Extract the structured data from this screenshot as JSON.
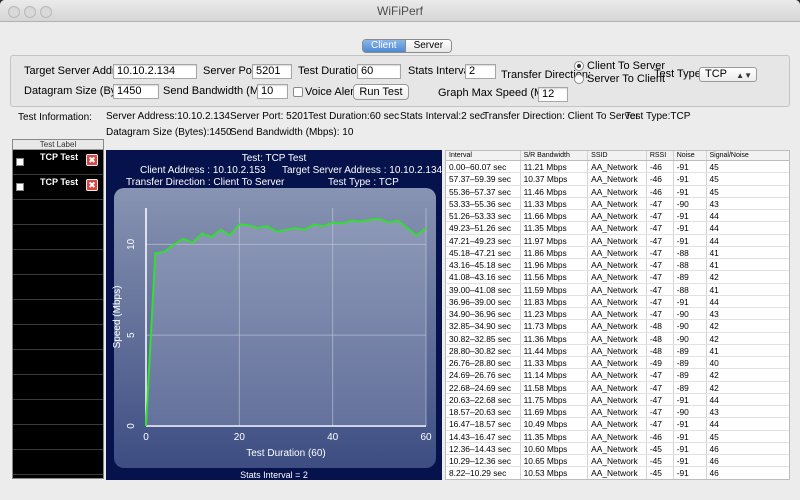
{
  "window": {
    "title": "WiFiPerf"
  },
  "tabs": [
    {
      "label": "Client",
      "selected": true
    },
    {
      "label": "Server",
      "selected": false
    }
  ],
  "config": {
    "target_server_address_label": "Target Server Address:",
    "target_server_address": "10.10.2.134",
    "server_port_label": "Server Port:",
    "server_port": "5201",
    "test_duration_label": "Test Duration:",
    "test_duration": "60",
    "stats_interval_label": "Stats Interval:",
    "stats_interval": "2",
    "transfer_direction_label": "Transfer Direction:",
    "direction_options": [
      "Client To Server",
      "Server To Client"
    ],
    "direction_selected": 0,
    "test_type_label": "Test Type:",
    "test_type": "TCP",
    "datagram_size_label": "Datagram Size (Bytes):",
    "datagram_size": "1450",
    "send_bandwidth_label": "Send Bandwidth (Mbps):",
    "send_bandwidth": "10",
    "voice_alert_label": "Voice Alert",
    "voice_alert": false,
    "run_test_label": "Run Test",
    "graph_max_speed_label": "Graph Max Speed (Mbps):",
    "graph_max_speed": "12"
  },
  "info": {
    "label": "Test Information:",
    "server_address": "Server Address:10.10.2.134",
    "server_port": "Server Port: 5201",
    "test_duration": "Test Duration:60 sec",
    "stats_interval": "Stats Interval:2 sec",
    "transfer_direction": "Transfer Direction: Client To Server",
    "test_type": "Test Type:TCP",
    "datagram_size": "Datagram Size (Bytes):1450",
    "send_bandwidth": "Send Bandwidth (Mbps): 10"
  },
  "test_list": {
    "header": "Test Label",
    "items": [
      {
        "label": "TCP Test"
      },
      {
        "label": "TCP Test"
      }
    ],
    "remove_glyph": "✖"
  },
  "graph": {
    "title": "Test: TCP Test",
    "client_address": "Client Address : 10.10.2.153",
    "target_server_address": "Target Server Address : 10.10.2.134",
    "transfer_direction": "Transfer Direction : Client To Server",
    "test_type": "Test Type : TCP",
    "stats_interval": "Stats Interval = 2"
  },
  "chart_data": {
    "type": "line",
    "xlabel": "Test Duration (60)",
    "ylabel": "Speed (Mbps)",
    "xlim": [
      0,
      60
    ],
    "ylim": [
      0,
      12
    ],
    "xticks": [
      0,
      20,
      40,
      60
    ],
    "yticks": [
      0,
      5,
      10
    ],
    "grid": true,
    "line_color": "#33dd33",
    "series": [
      {
        "x": [
          0,
          2,
          4,
          6,
          8,
          10,
          12,
          14,
          16,
          18,
          20,
          22,
          24,
          26,
          28,
          30,
          32,
          34,
          36,
          38,
          40,
          42,
          44,
          46,
          48,
          50,
          52,
          54,
          56,
          58,
          60
        ],
        "values": [
          0,
          9.5,
          9.6,
          10,
          10.3,
          10.1,
          10.6,
          10.4,
          10.8,
          10.5,
          11.1,
          11.05,
          10.9,
          11.0,
          10.7,
          10.8,
          10.9,
          10.8,
          11.1,
          11.0,
          11.2,
          11.15,
          11.3,
          11.25,
          11.35,
          11.4,
          11.2,
          11.3,
          10.9,
          10.5,
          10.9
        ]
      }
    ]
  },
  "table": {
    "columns": [
      "Interval",
      "S/R Bandwidth",
      "SSID",
      "RSSI",
      "Noise",
      "Signal/Noise"
    ],
    "rows": [
      [
        "0.00–60.07 sec",
        "11.21 Mbps",
        "AA_Network",
        "-46",
        "-91",
        "45"
      ],
      [
        "57.37–59.39 sec",
        "10.37 Mbps",
        "AA_Network",
        "-46",
        "-91",
        "45"
      ],
      [
        "55.36–57.37 sec",
        "11.46 Mbps",
        "AA_Network",
        "-46",
        "-91",
        "45"
      ],
      [
        "53.33–55.36 sec",
        "11.33 Mbps",
        "AA_Network",
        "-47",
        "-90",
        "43"
      ],
      [
        "51.26–53.33 sec",
        "11.66 Mbps",
        "AA_Network",
        "-47",
        "-91",
        "44"
      ],
      [
        "49.23–51.26 sec",
        "11.35 Mbps",
        "AA_Network",
        "-47",
        "-91",
        "44"
      ],
      [
        "47.21–49.23 sec",
        "11.97 Mbps",
        "AA_Network",
        "-47",
        "-91",
        "44"
      ],
      [
        "45.18–47.21 sec",
        "11.86 Mbps",
        "AA_Network",
        "-47",
        "-88",
        "41"
      ],
      [
        "43.16–45.18 sec",
        "11.96 Mbps",
        "AA_Network",
        "-47",
        "-88",
        "41"
      ],
      [
        "41.08–43.16 sec",
        "11.56 Mbps",
        "AA_Network",
        "-47",
        "-89",
        "42"
      ],
      [
        "39.00–41.08 sec",
        "11.59 Mbps",
        "AA_Network",
        "-47",
        "-88",
        "41"
      ],
      [
        "36.96–39.00 sec",
        "11.83 Mbps",
        "AA_Network",
        "-47",
        "-91",
        "44"
      ],
      [
        "34.90–36.96 sec",
        "11.23 Mbps",
        "AA_Network",
        "-47",
        "-90",
        "43"
      ],
      [
        "32.85–34.90 sec",
        "11.73 Mbps",
        "AA_Network",
        "-48",
        "-90",
        "42"
      ],
      [
        "30.82–32.85 sec",
        "11.36 Mbps",
        "AA_Network",
        "-48",
        "-90",
        "42"
      ],
      [
        "28.80–30.82 sec",
        "11.44 Mbps",
        "AA_Network",
        "-48",
        "-89",
        "41"
      ],
      [
        "26.76–28.80 sec",
        "11.33 Mbps",
        "AA_Network",
        "-49",
        "-89",
        "40"
      ],
      [
        "24.69–26.76 sec",
        "11.14 Mbps",
        "AA_Network",
        "-47",
        "-89",
        "42"
      ],
      [
        "22.68–24.69 sec",
        "11.58 Mbps",
        "AA_Network",
        "-47",
        "-89",
        "42"
      ],
      [
        "20.63–22.68 sec",
        "11.75 Mbps",
        "AA_Network",
        "-47",
        "-91",
        "44"
      ],
      [
        "18.57–20.63 sec",
        "11.69 Mbps",
        "AA_Network",
        "-47",
        "-90",
        "43"
      ],
      [
        "16.47–18.57 sec",
        "10.49 Mbps",
        "AA_Network",
        "-47",
        "-91",
        "44"
      ],
      [
        "14.43–16.47 sec",
        "11.35 Mbps",
        "AA_Network",
        "-46",
        "-91",
        "45"
      ],
      [
        "12.36–14.43 sec",
        "10.60 Mbps",
        "AA_Network",
        "-45",
        "-91",
        "46"
      ],
      [
        "10.29–12.36 sec",
        "10.65 Mbps",
        "AA_Network",
        "-45",
        "-91",
        "46"
      ],
      [
        "8.22–10.29 sec",
        "10.53 Mbps",
        "AA_Network",
        "-45",
        "-91",
        "46"
      ]
    ]
  }
}
